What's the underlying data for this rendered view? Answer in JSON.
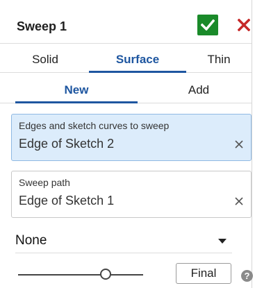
{
  "header": {
    "title": "Sweep 1",
    "accept_icon": "checkmark-icon",
    "cancel_icon": "close-icon",
    "accent_green": "#1a8a2a",
    "accent_red": "#c62828"
  },
  "type_tabs": [
    {
      "label": "Solid",
      "active": false
    },
    {
      "label": "Surface",
      "active": true
    },
    {
      "label": "Thin",
      "active": false
    }
  ],
  "mode_tabs": [
    {
      "label": "New",
      "active": true
    },
    {
      "label": "Add",
      "active": false
    }
  ],
  "fields": {
    "edges": {
      "label": "Edges and sketch curves to sweep",
      "value": "Edge of Sketch 2",
      "clear_icon": "close-icon"
    },
    "path": {
      "label": "Sweep path",
      "value": "Edge of Sketch 1",
      "clear_icon": "close-icon"
    }
  },
  "dropdown": {
    "value": "None",
    "icon": "caret-down-icon"
  },
  "footer": {
    "slider_icon": "slider-thumb",
    "final_label": "Final",
    "help_label": "?",
    "help_icon": "help-icon"
  },
  "colors": {
    "accent_blue": "#1e56a0",
    "active_field_bg": "#dcecfb"
  }
}
